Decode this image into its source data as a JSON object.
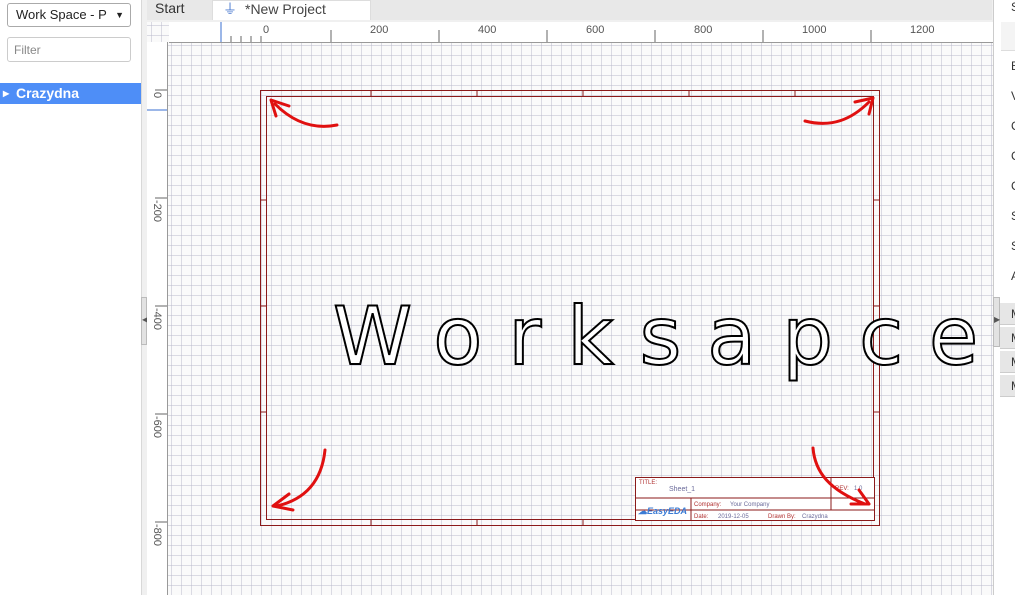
{
  "left_panel": {
    "workspace_select": "Work Space - P",
    "filter_placeholder": "Filter",
    "tree": [
      {
        "label": "Crazydna",
        "selected": true
      }
    ]
  },
  "tabs": [
    {
      "label": "Start",
      "active": false
    },
    {
      "label": "*New Project",
      "active": true
    }
  ],
  "ruler": {
    "top_labels": [
      "0",
      "200",
      "400",
      "600",
      "800",
      "1000",
      "1200"
    ],
    "left_labels": [
      "0",
      "-200",
      "-400",
      "-600",
      "-800"
    ]
  },
  "canvas": {
    "main_text": "Worksapce",
    "annotation_color": "#e01010"
  },
  "title_block": {
    "title_label": "TITLE:",
    "sheet_name": "Sheet_1",
    "rev_label": "REV:",
    "rev_value": "1.0",
    "company_label": "Company:",
    "company_value": "Your Company",
    "date_label": "Date:",
    "date_value": "2019-12-05",
    "drawn_label": "Drawn By:",
    "drawn_value": "Crazydna",
    "logo": "EasyEDA"
  },
  "right_panel": {
    "top_letter": "S",
    "letters": [
      "E",
      "V",
      "C",
      "C",
      "C",
      "S",
      "S",
      "A"
    ],
    "rows": [
      "M",
      "M",
      "M",
      "M"
    ]
  },
  "colors": {
    "selection": "#4e8ef7",
    "sheet_border": "#8b1a1a",
    "tab_icon": "#4b7bd0"
  }
}
